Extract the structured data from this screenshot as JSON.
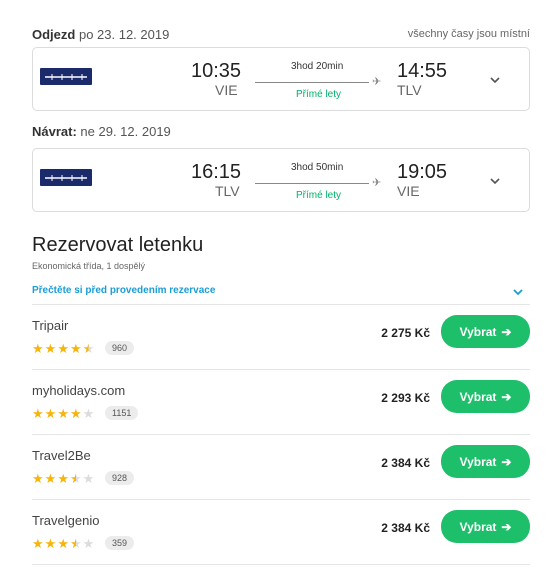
{
  "outbound": {
    "label": "Odjezd",
    "date": "po 23. 12. 2019",
    "local_times_note": "všechny časy jsou místní",
    "airline_logo_text": "ELAL",
    "dep_time": "10:35",
    "dep_code": "VIE",
    "duration": "3hod 20min",
    "direct": "Přímé lety",
    "arr_time": "14:55",
    "arr_code": "TLV"
  },
  "return_flight": {
    "label": "Návrat:",
    "date": "ne 29. 12. 2019",
    "airline_logo_text": "ELAL",
    "dep_time": "16:15",
    "dep_code": "TLV",
    "duration": "3hod 50min",
    "direct": "Přímé lety",
    "arr_time": "19:05",
    "arr_code": "VIE"
  },
  "booking": {
    "title": "Rezervovat letenku",
    "subtitle": "Ekonomická třída, 1 dospělý",
    "read_before": "Přečtěte si před provedením rezervace"
  },
  "offers": [
    {
      "name": "Tripair",
      "rating": 4.5,
      "reviews": "960",
      "price": "2 275 Kč",
      "button": "Vybrat"
    },
    {
      "name": "myholidays.com",
      "rating": 4,
      "reviews": "1151",
      "price": "2 293 Kč",
      "button": "Vybrat"
    },
    {
      "name": "Travel2Be",
      "rating": 3.5,
      "reviews": "928",
      "price": "2 384 Kč",
      "button": "Vybrat"
    },
    {
      "name": "Travelgenio",
      "rating": 3.5,
      "reviews": "359",
      "price": "2 384 Kč",
      "button": "Vybrat"
    }
  ],
  "colors": {
    "accent_green": "#1dbf6a",
    "link_blue": "#1a9ed4",
    "star_gold": "#f7b40a",
    "airline_navy": "#1b2a6b"
  }
}
